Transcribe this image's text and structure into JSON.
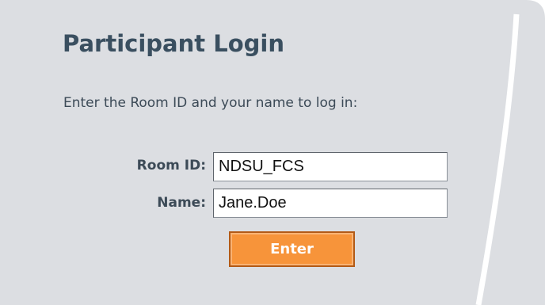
{
  "login": {
    "title": "Participant Login",
    "instructions": "Enter the Room ID and your name to log in:",
    "room_label": "Room ID:",
    "room_value": "NDSU_FCS",
    "name_label": "Name:",
    "name_value": "Jane.Doe",
    "enter_label": "Enter"
  },
  "colors": {
    "panel": "#dcdee2",
    "title": "#3a4f60",
    "text": "#3c4a57",
    "button": "#f7943a",
    "button_border": "#b35a16"
  }
}
